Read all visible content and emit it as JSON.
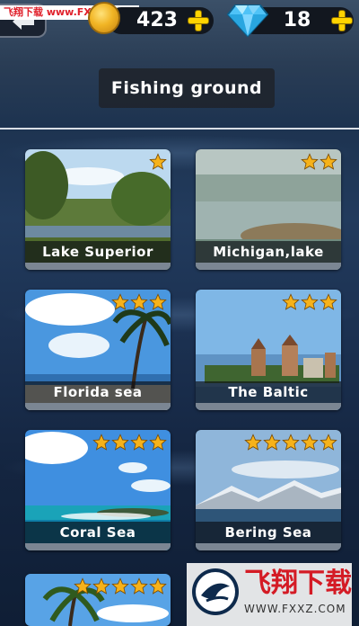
{
  "header": {
    "watermark": "飞翔下载 www.FXXZ.COM",
    "coins": "423",
    "gems": "18"
  },
  "page_title": "Fishing ground",
  "grounds": [
    {
      "name": "Lake Superior",
      "stars": 1
    },
    {
      "name": "Michigan,lake",
      "stars": 2
    },
    {
      "name": "Florida sea",
      "stars": 3
    },
    {
      "name": "The Baltic",
      "stars": 3
    },
    {
      "name": "Coral Sea",
      "stars": 4
    },
    {
      "name": "Bering Sea",
      "stars": 5
    },
    {
      "name": "",
      "stars": 5
    }
  ],
  "footer_watermark": {
    "brand_cn": "飞翔下载",
    "url": "WWW.FXXZ.COM"
  },
  "colors": {
    "star": "#f6b21a",
    "plus": "#ffd400",
    "watermark_red": "#d41b25"
  }
}
